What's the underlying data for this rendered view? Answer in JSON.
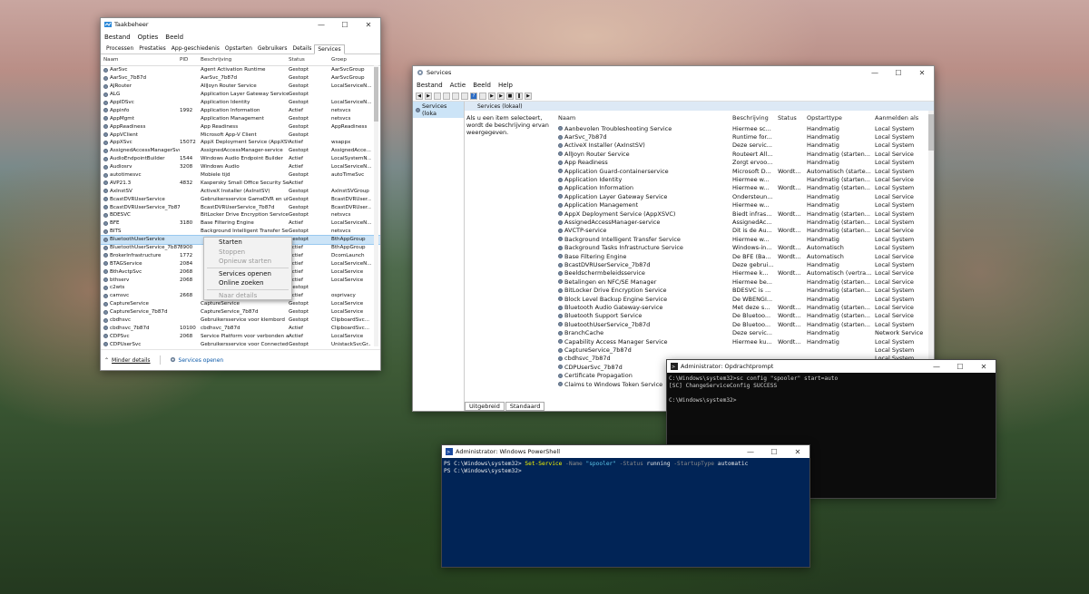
{
  "taskmgr": {
    "title": "Taakbeheer",
    "menu": [
      "Bestand",
      "Opties",
      "Beeld"
    ],
    "tabs": [
      "Processen",
      "Prestaties",
      "App-geschiedenis",
      "Opstarten",
      "Gebruikers",
      "Details",
      "Services"
    ],
    "columns": [
      "Naam",
      "PID",
      "Beschrijving",
      "Status",
      "Groep"
    ],
    "rows": [
      [
        "AarSvc",
        "",
        "Agent Activation Runtime",
        "Gestopt",
        "AarSvcGroup"
      ],
      [
        "AarSvc_7b87d",
        "",
        "AarSvc_7b87d",
        "Gestopt",
        "AarSvcGroup"
      ],
      [
        "AJRouter",
        "",
        "AllJoyn Router Service",
        "Gestopt",
        "LocalServiceN..."
      ],
      [
        "ALG",
        "",
        "Application Layer Gateway Service",
        "Gestopt",
        ""
      ],
      [
        "AppIDSvc",
        "",
        "Application Identity",
        "Gestopt",
        "LocalServiceN..."
      ],
      [
        "Appinfo",
        "1992",
        "Application Information",
        "Actief",
        "netsvcs"
      ],
      [
        "AppMgmt",
        "",
        "Application Management",
        "Gestopt",
        "netsvcs"
      ],
      [
        "AppReadiness",
        "",
        "App Readiness",
        "Gestopt",
        "AppReadiness"
      ],
      [
        "AppVClient",
        "",
        "Microsoft App-V Client",
        "Gestopt",
        ""
      ],
      [
        "AppXSvc",
        "15072",
        "AppX Deployment Service (AppXSV...",
        "Actief",
        "wsappx"
      ],
      [
        "AssignedAccessManagerSvc",
        "",
        "AssignedAccessManager-service",
        "Gestopt",
        "AssignedAcce..."
      ],
      [
        "AudioEndpointBuilder",
        "1544",
        "Windows Audio Endpoint Builder",
        "Actief",
        "LocalSystemN..."
      ],
      [
        "Audiosrv",
        "3208",
        "Windows Audio",
        "Actief",
        "LocalServiceN..."
      ],
      [
        "autotimesvc",
        "",
        "Mobiele tijd",
        "Gestopt",
        "autoTimeSvc"
      ],
      [
        "AVP21.3",
        "4832",
        "Kaspersky Small Office Security Ser...",
        "Actief",
        ""
      ],
      [
        "AxInstSV",
        "",
        "ActiveX Installer (AxInstSV)",
        "Gestopt",
        "AxInstSVGroup"
      ],
      [
        "BcastDVRUserService",
        "",
        "Gebruikersservice GameDVR en uit...",
        "Gestopt",
        "BcastDVRUser..."
      ],
      [
        "BcastDVRUserService_7b87d",
        "",
        "BcastDVRUserService_7b87d",
        "Gestopt",
        "BcastDVRUser..."
      ],
      [
        "BDESVC",
        "",
        "BitLocker Drive Encryption Service",
        "Gestopt",
        "netsvcs"
      ],
      [
        "BFE",
        "3180",
        "Base Filtering Engine",
        "Actief",
        "LocalServiceN..."
      ],
      [
        "BITS",
        "",
        "Background Intelligent Transfer Ser...",
        "Gestopt",
        "netsvcs"
      ],
      [
        "BluetoothUserService",
        "",
        "",
        "Gestopt",
        "BthAppGroup"
      ],
      [
        "BluetoothUserService_7b87d",
        "8900",
        "",
        "Actief",
        "BthAppGroup"
      ],
      [
        "BrokerInfrastructure",
        "1772",
        "",
        "Actief",
        "DcomLaunch"
      ],
      [
        "BTAGService",
        "2084",
        "",
        "Actief",
        "LocalServiceN..."
      ],
      [
        "BthAvctpSvc",
        "2068",
        "",
        "Actief",
        "LocalService"
      ],
      [
        "bthserv",
        "2068",
        "",
        "Actief",
        "LocalService"
      ],
      [
        "c2wts",
        "",
        "",
        "Gestopt",
        ""
      ],
      [
        "camsvc",
        "2668",
        "",
        "Actief",
        "osprivacy"
      ],
      [
        "CaptureService",
        "",
        "CaptureService",
        "Gestopt",
        "LocalService"
      ],
      [
        "CaptureService_7b87d",
        "",
        "CaptureService_7b87d",
        "Gestopt",
        "LocalService"
      ],
      [
        "cbdhsvc",
        "",
        "Gebruikersservice voor klembord",
        "Gestopt",
        "ClipboardSvc..."
      ],
      [
        "cbdhsvc_7b87d",
        "10100",
        "cbdhsvc_7b87d",
        "Actief",
        "ClipboardSvc..."
      ],
      [
        "CDPSvc",
        "2068",
        "Service Platform voor verbonden a...",
        "Actief",
        "LocalService"
      ],
      [
        "CDPUserSvc",
        "",
        "Gebruikersservice voor Connected ...",
        "Gestopt",
        "UnistackSvcGr..."
      ]
    ],
    "selected_row": 21,
    "footer_less": "Minder details",
    "footer_open": "Services openen"
  },
  "context_menu": {
    "items": [
      {
        "label": "Starten",
        "disabled": false
      },
      {
        "label": "Stoppen",
        "disabled": true
      },
      {
        "label": "Opnieuw starten",
        "disabled": true
      },
      {
        "label": "Services openen",
        "disabled": false
      },
      {
        "label": "Online zoeken",
        "disabled": false
      },
      {
        "label": "Naar details",
        "disabled": true
      }
    ]
  },
  "services": {
    "title": "Services",
    "menu": [
      "Bestand",
      "Actie",
      "Beeld",
      "Help"
    ],
    "tree_node": "Services (lokaal)",
    "tree_node_short": "Services (loka",
    "pane_title": "Services (lokaal)",
    "description": "Als u een item selecteert, wordt de beschrijving ervan weergegeven.",
    "columns": [
      "Naam",
      "Beschrijving",
      "Status",
      "Opstarttype",
      "Aanmelden als"
    ],
    "rows": [
      [
        "Aanbevolen Troubleshooting Service",
        "Hiermee sc...",
        "",
        "Handmatig",
        "Local System"
      ],
      [
        "AarSvc_7b87d",
        "Runtime for...",
        "",
        "Handmatig",
        "Local System"
      ],
      [
        "ActiveX Installer (AxInstSV)",
        "Deze servic...",
        "",
        "Handmatig",
        "Local System"
      ],
      [
        "AllJoyn Router Service",
        "Routeert All...",
        "",
        "Handmatig (starten...",
        "Local Service"
      ],
      [
        "App Readiness",
        "Zorgt ervoo...",
        "",
        "Handmatig",
        "Local System"
      ],
      [
        "Application Guard-containerservice",
        "Microsoft D...",
        "Wordt...",
        "Automatisch (starte...",
        "Local System"
      ],
      [
        "Application Identity",
        "Hiermee w...",
        "",
        "Handmatig (starten...",
        "Local Service"
      ],
      [
        "Application Information",
        "Hiermee w...",
        "Wordt...",
        "Handmatig (starten...",
        "Local System"
      ],
      [
        "Application Layer Gateway Service",
        "Ondersteun...",
        "",
        "Handmatig",
        "Local Service"
      ],
      [
        "Application Management",
        "Hiermee w...",
        "",
        "Handmatig",
        "Local System"
      ],
      [
        "AppX Deployment Service (AppXSVC)",
        "Biedt infras...",
        "Wordt...",
        "Handmatig (starten...",
        "Local System"
      ],
      [
        "AssignedAccessManager-service",
        "AssignedAc...",
        "",
        "Handmatig (starten...",
        "Local System"
      ],
      [
        "AVCTP-service",
        "Dit is de Au...",
        "Wordt...",
        "Handmatig (starten...",
        "Local Service"
      ],
      [
        "Background Intelligent Transfer Service",
        "Hiermee w...",
        "",
        "Handmatig",
        "Local System"
      ],
      [
        "Background Tasks Infrastructure Service",
        "Windows-in...",
        "Wordt...",
        "Automatisch",
        "Local System"
      ],
      [
        "Base Filtering Engine",
        "De BFE (Ba...",
        "Wordt...",
        "Automatisch",
        "Local Service"
      ],
      [
        "BcastDVRUserService_7b87d",
        "Deze gebrui...",
        "",
        "Handmatig",
        "Local System"
      ],
      [
        "Beeldschermbeleidsservice",
        "Hiermee k...",
        "Wordt...",
        "Automatisch (vertra...",
        "Local Service"
      ],
      [
        "Betalingen en NFC/SE Manager",
        "Hiermee be...",
        "",
        "Handmatig (starten...",
        "Local Service"
      ],
      [
        "BitLocker Drive Encryption Service",
        "BDESVC is ...",
        "",
        "Handmatig (starten...",
        "Local System"
      ],
      [
        "Block Level Backup Engine Service",
        "De WBENGI...",
        "",
        "Handmatig",
        "Local System"
      ],
      [
        "Bluetooth Audio Gateway-service",
        "Met deze s...",
        "Wordt...",
        "Handmatig (starten...",
        "Local Service"
      ],
      [
        "Bluetooth Support Service",
        "De Bluetoo...",
        "Wordt...",
        "Handmatig (starten...",
        "Local Service"
      ],
      [
        "BluetoothUserService_7b87d",
        "De Bluetoo...",
        "Wordt...",
        "Handmatig (starten...",
        "Local System"
      ],
      [
        "BranchCache",
        "Deze servic...",
        "",
        "Handmatig",
        "Network Service"
      ],
      [
        "Capability Access Manager Service",
        "Hiermee ku...",
        "Wordt...",
        "Handmatig",
        "Local System"
      ],
      [
        "CaptureService_7b87d",
        "",
        "",
        "",
        "Local System"
      ],
      [
        "cbdhsvc_7b87d",
        "",
        "",
        "",
        "Local System"
      ],
      [
        "CDPUserSvc_7b87d",
        "",
        "",
        "",
        ""
      ],
      [
        "Certificate Propagation",
        "",
        "",
        "",
        ""
      ],
      [
        "Claims to Windows Token Service",
        "",
        "",
        "",
        ""
      ]
    ],
    "tabs": [
      "Uitgebreid",
      "Standaard"
    ]
  },
  "cmd": {
    "title": "Administrator: Opdrachtprompt",
    "lines": [
      "C:\\Windows\\system32>sc config \"spooler\" start=auto",
      "[SC] ChangeServiceConfig SUCCESS",
      "",
      "C:\\Windows\\system32>"
    ]
  },
  "powershell": {
    "title": "Administrator: Windows PowerShell",
    "prompt1": "PS C:\\Windows\\system32> ",
    "cmdlet": "Set-Service",
    "p_name": " -Name ",
    "v_name": "\"spooler\"",
    "p_status": " -Status ",
    "v_status": "running",
    "p_start": " -StartupType ",
    "v_start": "automatic",
    "prompt2": "PS C:\\Windows\\system32>"
  }
}
